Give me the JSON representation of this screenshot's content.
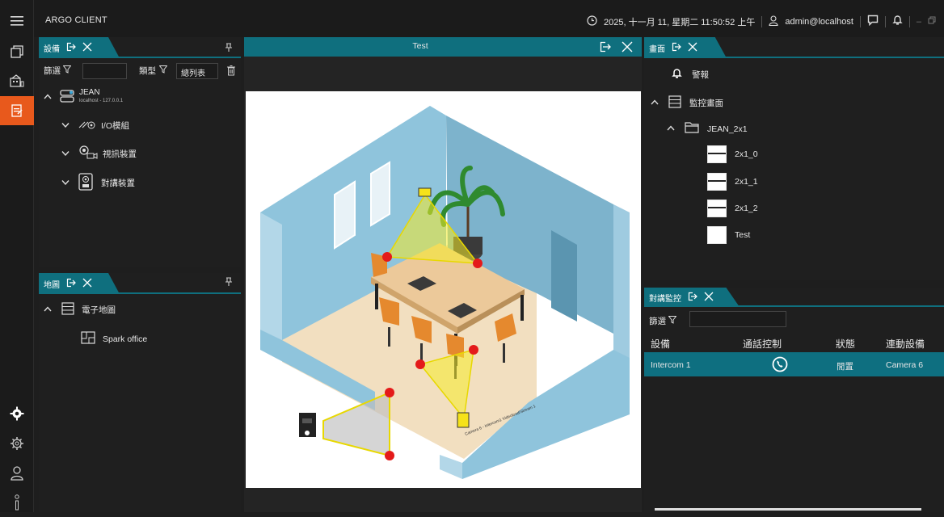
{
  "app": {
    "title": "ARGO CLIENT"
  },
  "status_bar": {
    "datetime": "2025, 十一月 11, 星期二 11:50:52 上午",
    "user": "admin@localhost"
  },
  "rail": {
    "items": [
      "menu",
      "window",
      "devices",
      "events",
      "settings",
      "gear",
      "user",
      "info"
    ]
  },
  "device_panel": {
    "tab_label": "設備",
    "filter_label": "篩選",
    "type_label": "類型",
    "type_value": "總列表",
    "server": {
      "name": "JEAN",
      "address": "localhost - 127.0.0.1"
    },
    "groups": [
      {
        "label": "I/O模組"
      },
      {
        "label": "視訊裝置"
      },
      {
        "label": "對講裝置"
      }
    ]
  },
  "map_panel": {
    "tab_label": "地圖",
    "group_label": "電子地圖",
    "item_label": "Spark office"
  },
  "viewer": {
    "tab_label": "Test"
  },
  "screen_panel": {
    "tab_label": "畫面",
    "alarm_label": "警報",
    "group_label": "監控畫面",
    "folder_label": "JEAN_2x1",
    "items": [
      "2x1_0",
      "2x1_1",
      "2x1_2",
      "Test"
    ]
  },
  "intercom_panel": {
    "tab_label": "對講監控",
    "filter_label": "篩選",
    "columns": [
      "設備",
      "通話控制",
      "狀態",
      "連動設備"
    ],
    "rows": [
      {
        "device": "Intercom 1",
        "status": "閒置",
        "linked": "Camera 6"
      }
    ]
  },
  "map_overlay": {
    "camera_label": "Camera 6 - Intercom1 Videoload/Stream 1"
  },
  "colors": {
    "accent": "#0f6f7e",
    "active_rail": "#e8591c",
    "selected_row": "#0e6f80"
  }
}
